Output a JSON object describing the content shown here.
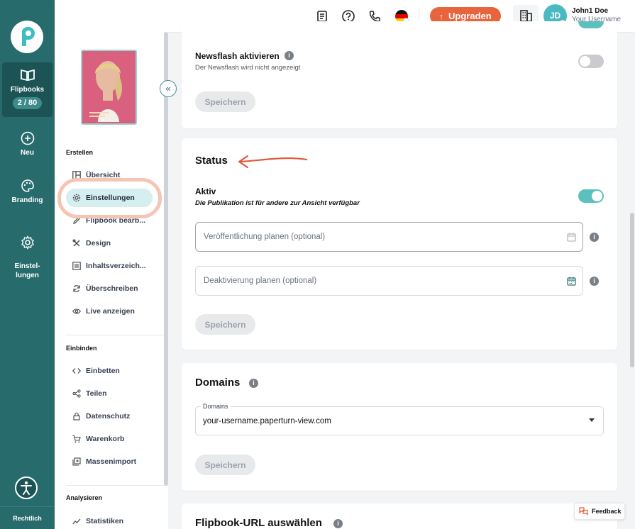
{
  "rail": {
    "items": [
      {
        "label": "Flipbooks",
        "badge": "2 / 80"
      },
      {
        "label": "Neu"
      },
      {
        "label": "Branding"
      },
      {
        "label": "Einstel-\nlungen"
      }
    ],
    "footer": "Rechtlich"
  },
  "topbar": {
    "upgrade_label": "Upgraden",
    "avatar_initials": "JD",
    "user_name": "John1 Doe",
    "user_sub": "Your Username"
  },
  "subnav": {
    "sections": [
      {
        "title": "Erstellen",
        "items": [
          "Übersicht",
          "Einstellungen",
          "Flipbook bearb...",
          "Design",
          "Inhaltsverzeich...",
          "Überschreiben",
          "Live anzeigen"
        ]
      },
      {
        "title": "Einbinden",
        "items": [
          "Einbetten",
          "Teilen",
          "Datenschutz",
          "Warenkorb",
          "Massenimport"
        ]
      },
      {
        "title": "Analysieren",
        "items": [
          "Statistiken"
        ]
      }
    ],
    "active_item": "Einstellungen"
  },
  "newsflash": {
    "label": "Newsflash aktivieren",
    "sub": "Der Newsflash wird nicht angezeigt",
    "save": "Speichern"
  },
  "status": {
    "title": "Status",
    "aktiv_label": "Aktiv",
    "aktiv_sub": "Die Publikation ist für andere zur Ansicht verfügbar",
    "publish_placeholder": "Veröffentlichung planen (optional)",
    "deactivate_placeholder": "Deaktivierung planen (optional)",
    "save": "Speichern"
  },
  "domains": {
    "title": "Domains",
    "select_label": "Domains",
    "select_value": "your-username.paperturn-view.com",
    "save": "Speichern"
  },
  "url_section": {
    "title": "Flipbook-URL auswählen"
  },
  "feedback": "Feedback",
  "colors": {
    "rail": "#276b6d",
    "accent": "#e8643c",
    "toggle_on": "#5cc1bd",
    "active_nav": "#d5eeef"
  }
}
